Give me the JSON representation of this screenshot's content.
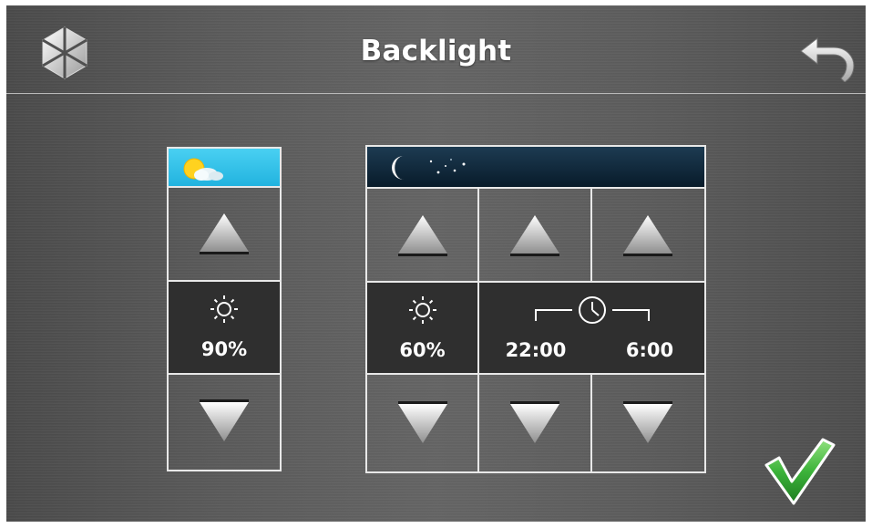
{
  "header": {
    "title": "Backlight"
  },
  "icons": {
    "logo": "hexagon-logo-icon",
    "back": "back-arrow-icon",
    "confirm": "checkmark-icon",
    "day": "sun-cloud-icon",
    "night": "moon-stars-icon",
    "brightness": "sun-icon",
    "clock": "clock-icon"
  },
  "day_panel": {
    "brightness_value": "90%"
  },
  "night_panel": {
    "brightness_value": "60%",
    "time_from": "22:00",
    "time_to": "6:00"
  },
  "colors": {
    "day_sky": "#2ec3ea",
    "night_sky": "#0f2a3d",
    "confirm_green": "#3cb33a",
    "value_bg": "#2f2f2f"
  }
}
